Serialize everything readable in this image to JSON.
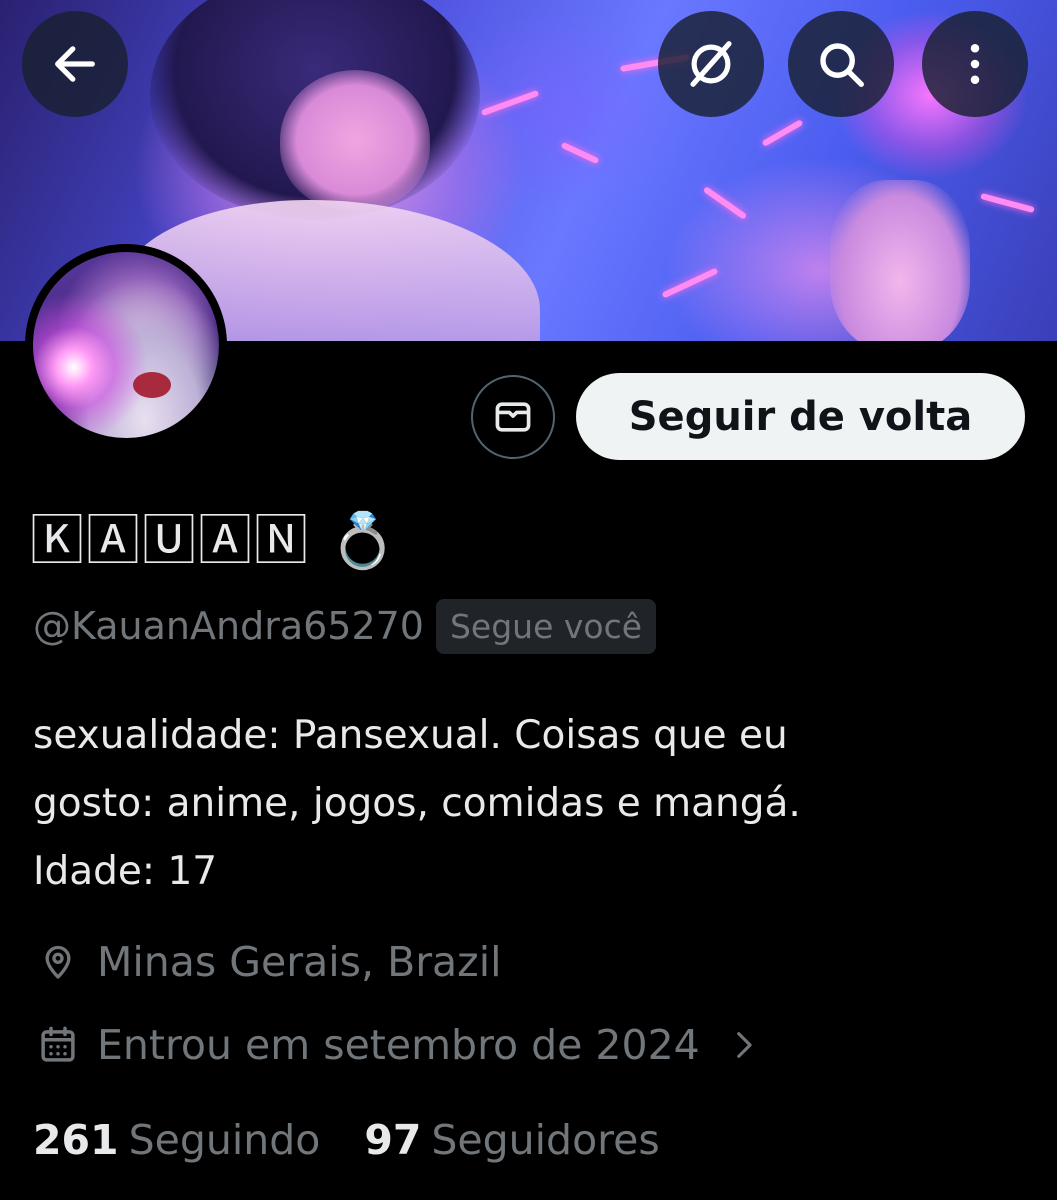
{
  "header": {
    "back_icon": "arrow-left-icon",
    "grok_icon": "grok-slash-circle-icon",
    "search_icon": "search-icon",
    "more_icon": "more-vertical-icon"
  },
  "profile": {
    "display_name": "🄺🄰🅄🄰🄽 💍",
    "handle": "@KauanAndra65270",
    "follows_you_badge": "Segue você",
    "follow_back_label": "Seguir de volta",
    "message_icon": "envelope-icon",
    "bio_lines": [
      "sexualidade: Pansexual. Coisas que eu",
      "gosto: anime, jogos, comidas e mangá.",
      "Idade: 17"
    ],
    "location": "Minas Gerais, Brazil",
    "joined": "Entrou em setembro de 2024",
    "stats": {
      "following_count": "261",
      "following_label": "Seguindo",
      "followers_count": "97",
      "followers_label": "Seguidores"
    }
  },
  "colors": {
    "background": "#000000",
    "primary_text": "#e7e9ea",
    "secondary_text": "#71767b",
    "follow_button_bg": "#eff3f4",
    "badge_bg": "#202327"
  }
}
